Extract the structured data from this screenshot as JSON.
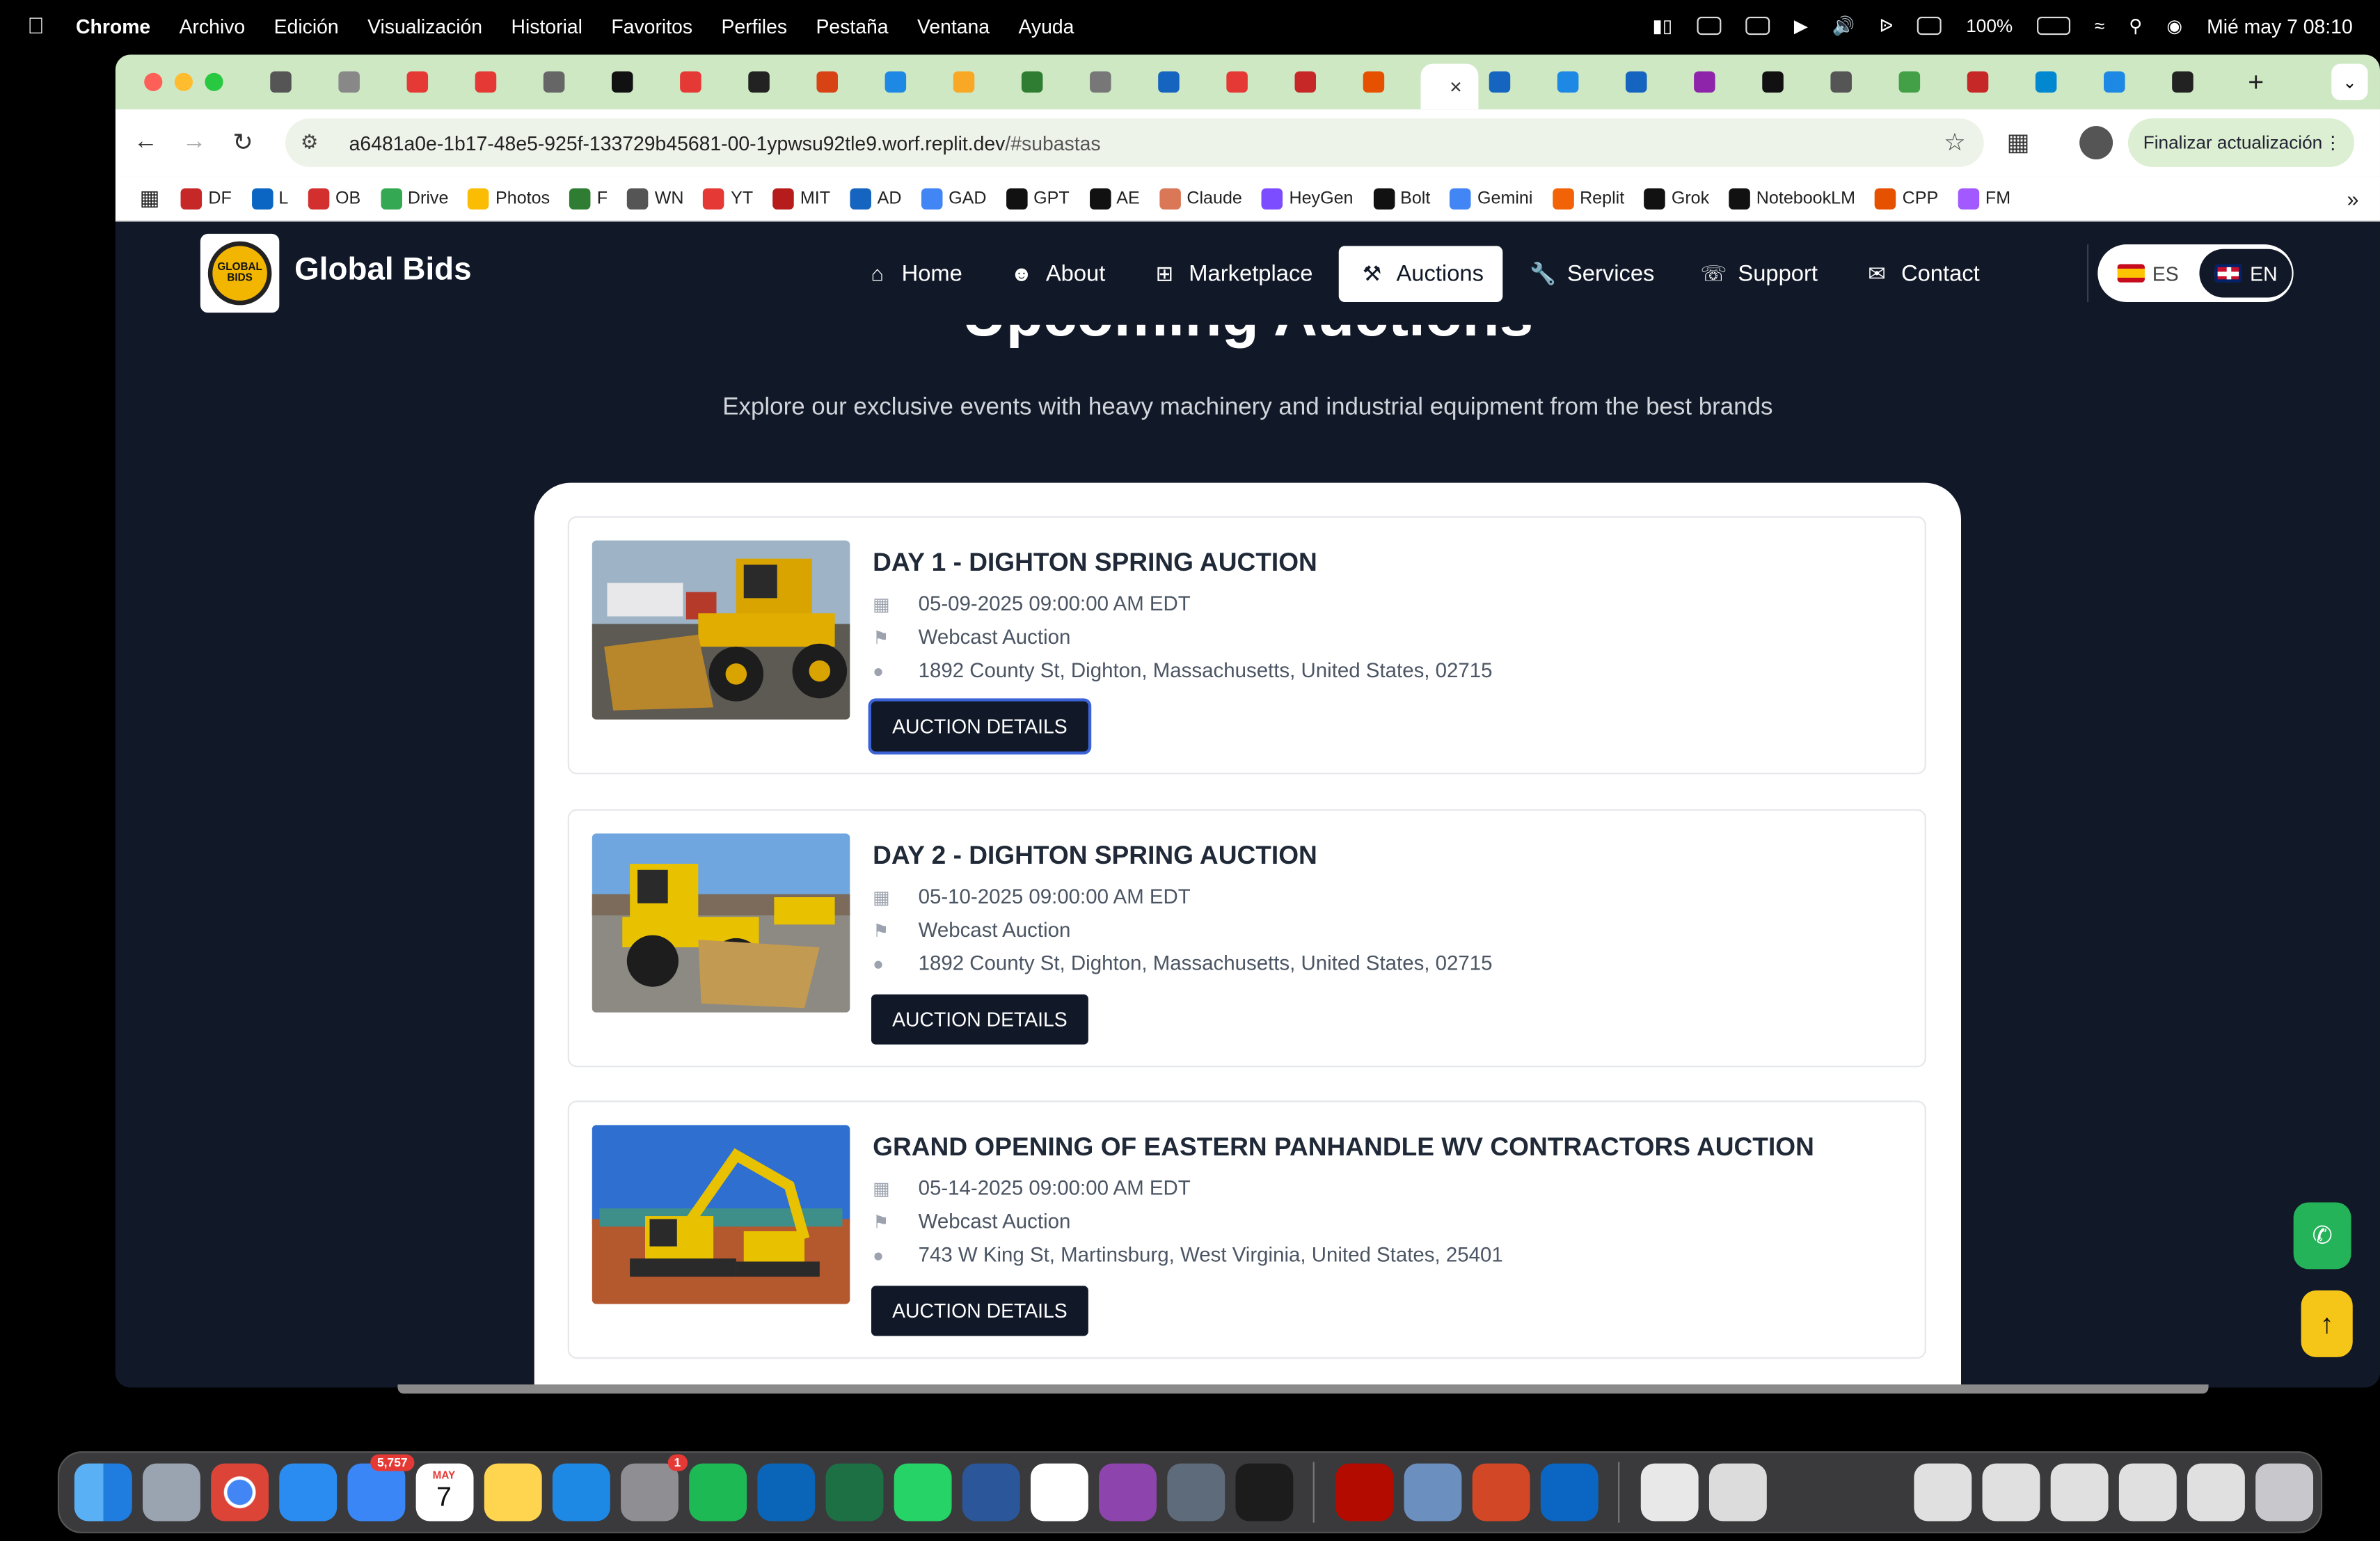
{
  "menubar": {
    "app": "Chrome",
    "items": [
      "Archivo",
      "Edición",
      "Visualización",
      "Historial",
      "Favoritos",
      "Perfiles",
      "Pestaña",
      "Ventana",
      "Ayuda"
    ],
    "battery": "100%",
    "datetime": "Mié may 7  08:10"
  },
  "browser": {
    "url_host": "a6481a0e-1b17-48e5-925f-133729b45681-00-1ypwsu92tle9.worf.replit.dev",
    "url_path": "/#subastas",
    "update_label": "Finalizar actualización",
    "tab_close": "×",
    "bookmarks": [
      "DF",
      "L",
      "OB",
      "Drive",
      "Photos",
      "F",
      "WN",
      "YT",
      "MIT",
      "AD",
      "GAD",
      "GPT",
      "AE",
      "Claude",
      "HeyGen",
      "Bolt",
      "Gemini",
      "Replit",
      "Grok",
      "NotebookLM",
      "CPP",
      "FM"
    ]
  },
  "site": {
    "brand": "Global Bids",
    "logo_text": "GLOBAL BIDS",
    "nav": [
      {
        "label": "Home",
        "icon": "home-icon"
      },
      {
        "label": "About",
        "icon": "users-icon"
      },
      {
        "label": "Marketplace",
        "icon": "grid-icon"
      },
      {
        "label": "Auctions",
        "icon": "gavel-icon"
      },
      {
        "label": "Services",
        "icon": "wrench-icon"
      },
      {
        "label": "Support",
        "icon": "headset-icon"
      },
      {
        "label": "Contact",
        "icon": "envelope-icon"
      }
    ],
    "active_nav": "Auctions",
    "lang": {
      "es": "ES",
      "en": "EN",
      "active": "EN"
    }
  },
  "hero": {
    "title": "Upcoming Auctions",
    "subtitle": "Explore our exclusive events with heavy machinery and industrial equipment from the best brands"
  },
  "auctions": [
    {
      "title": "DAY 1 - DIGHTON SPRING AUCTION",
      "date": "05-09-2025 09:00:00 AM EDT",
      "type": "Webcast Auction",
      "location": "1892 County St, Dighton, Massachusetts, United States, 02715",
      "button": "AUCTION DETAILS"
    },
    {
      "title": "DAY 2 - DIGHTON SPRING AUCTION",
      "date": "05-10-2025 09:00:00 AM EDT",
      "type": "Webcast Auction",
      "location": "1892 County St, Dighton, Massachusetts, United States, 02715",
      "button": "AUCTION DETAILS"
    },
    {
      "title": "GRAND OPENING OF EASTERN PANHANDLE WV CONTRACTORS AUCTION",
      "date": "05-14-2025 09:00:00 AM EDT",
      "type": "Webcast Auction",
      "location": "743 W King St, Martinsburg, West Virginia, United States, 25401",
      "button": "AUCTION DETAILS"
    }
  ],
  "dock": {
    "mail_badge": "5,757",
    "calendar_month": "MAY",
    "calendar_day": "7",
    "settings_badge": "1"
  },
  "colors": {
    "page_bg": "#111827",
    "accent_green": "#25b35a",
    "accent_yellow": "#f5c518",
    "tabstrip": "#cfe8c4"
  }
}
